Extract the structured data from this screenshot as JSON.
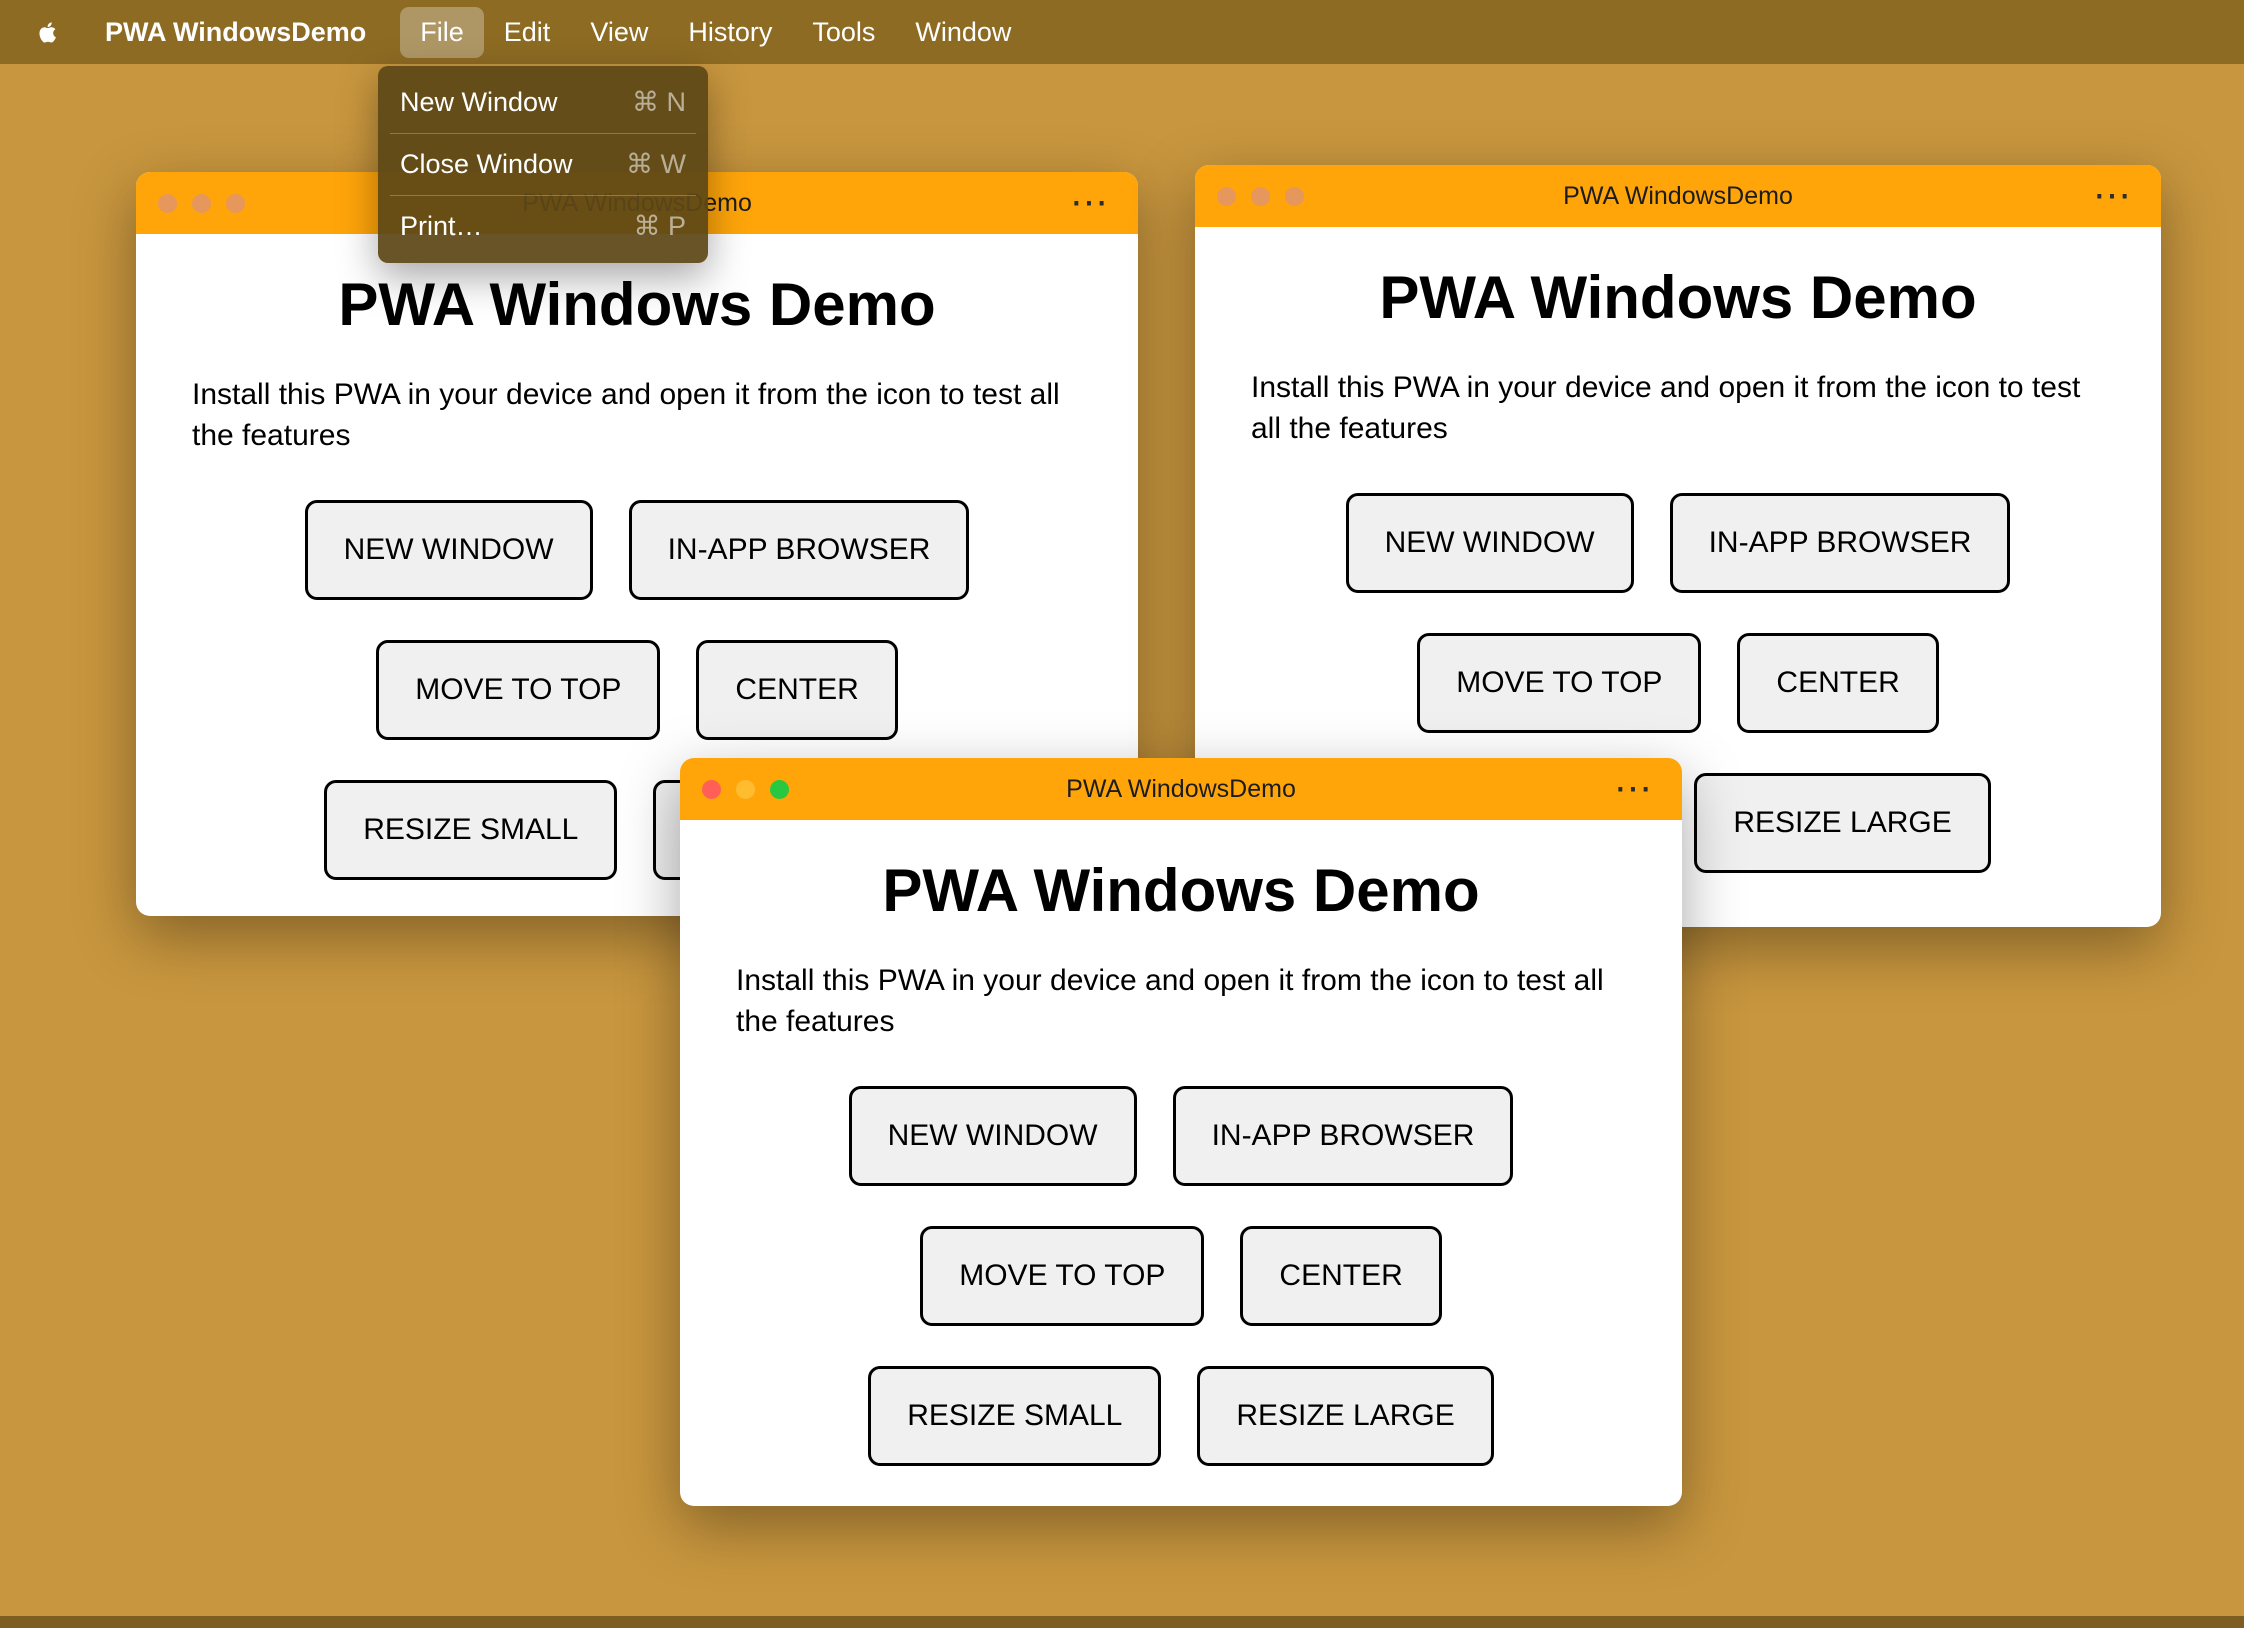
{
  "colors": {
    "desktop": "#c8963e",
    "menu_bar": "#8d6b23",
    "titlebar": "#ffa50a",
    "button_bg": "#f0f0f0",
    "active_traffic": [
      "#ff5f57",
      "#febc2e",
      "#28c840"
    ]
  },
  "menu_bar": {
    "app_name": "PWA WindowsDemo",
    "items": [
      {
        "label": "File"
      },
      {
        "label": "Edit"
      },
      {
        "label": "View"
      },
      {
        "label": "History"
      },
      {
        "label": "Tools"
      },
      {
        "label": "Window"
      }
    ]
  },
  "file_menu": {
    "items": [
      {
        "label": "New Window",
        "shortcut": "⌘ N"
      },
      {
        "label": "Close Window",
        "shortcut": "⌘ W"
      },
      {
        "label": "Print…",
        "shortcut": "⌘ P"
      }
    ]
  },
  "window": {
    "title": "PWA WindowsDemo",
    "ellipsis": "⋯",
    "heading": "PWA Windows Demo",
    "description": "Install this PWA in your device and open it from the icon to test all the features",
    "rows": [
      [
        "NEW WINDOW",
        "IN-APP BROWSER"
      ],
      [
        "MOVE TO TOP",
        "CENTER"
      ],
      [
        "RESIZE SMALL",
        "RESIZE LARGE"
      ]
    ]
  }
}
